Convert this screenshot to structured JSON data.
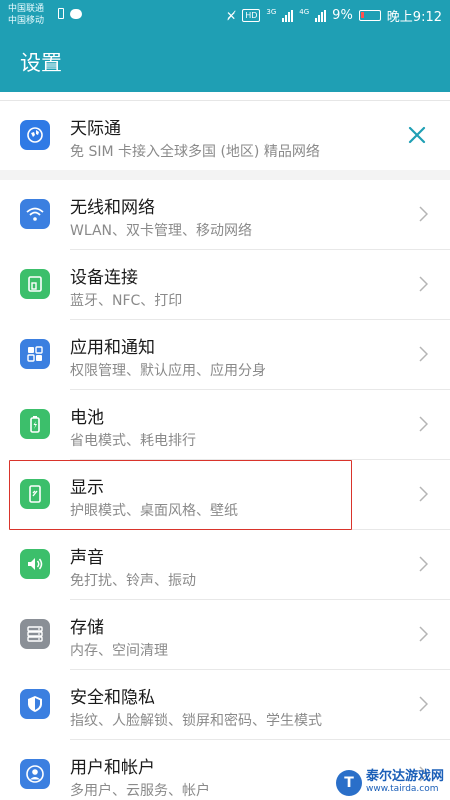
{
  "status_bar": {
    "carrier1": "中国联通",
    "carrier2": "中国移动",
    "hd_badge": "HD",
    "network1": "3G",
    "network2": "4G",
    "battery_percent": "9%",
    "time": "晚上9:12"
  },
  "app_bar": {
    "title": "设置"
  },
  "banner": {
    "title": "天际通",
    "subtitle": "免 SIM 卡接入全球多国 (地区) 精品网络",
    "icon": "globe-icon",
    "close_icon": "close-icon"
  },
  "items": [
    {
      "title": "无线和网络",
      "subtitle": "WLAN、双卡管理、移动网络",
      "icon": "wifi-icon",
      "color": "#3b7fe0"
    },
    {
      "title": "设备连接",
      "subtitle": "蓝牙、NFC、打印",
      "icon": "device-connection-icon",
      "color": "#3cbf6b"
    },
    {
      "title": "应用和通知",
      "subtitle": "权限管理、默认应用、应用分身",
      "icon": "apps-grid-icon",
      "color": "#3b7fe0"
    },
    {
      "title": "电池",
      "subtitle": "省电模式、耗电排行",
      "icon": "battery-icon",
      "color": "#3cbf6b"
    },
    {
      "title": "显示",
      "subtitle": "护眼模式、桌面风格、壁纸",
      "icon": "display-icon",
      "color": "#3cbf6b"
    },
    {
      "title": "声音",
      "subtitle": "免打扰、铃声、振动",
      "icon": "speaker-icon",
      "color": "#3cbf6b"
    },
    {
      "title": "存储",
      "subtitle": "内存、空间清理",
      "icon": "storage-icon",
      "color": "#8a8f96"
    },
    {
      "title": "安全和隐私",
      "subtitle": "指纹、人脸解锁、锁屏和密码、学生模式",
      "icon": "shield-icon",
      "color": "#3b7fe0"
    },
    {
      "title": "用户和帐户",
      "subtitle": "多用户、云服务、帐户",
      "icon": "user-icon",
      "color": "#3b7fe0"
    }
  ],
  "colors": {
    "header": "#1f9fb4",
    "highlight_border": "#d9342b",
    "accent_close": "#1f9fb4"
  },
  "watermark": {
    "name": "泰尔达游戏网",
    "url": "www.tairda.com"
  }
}
